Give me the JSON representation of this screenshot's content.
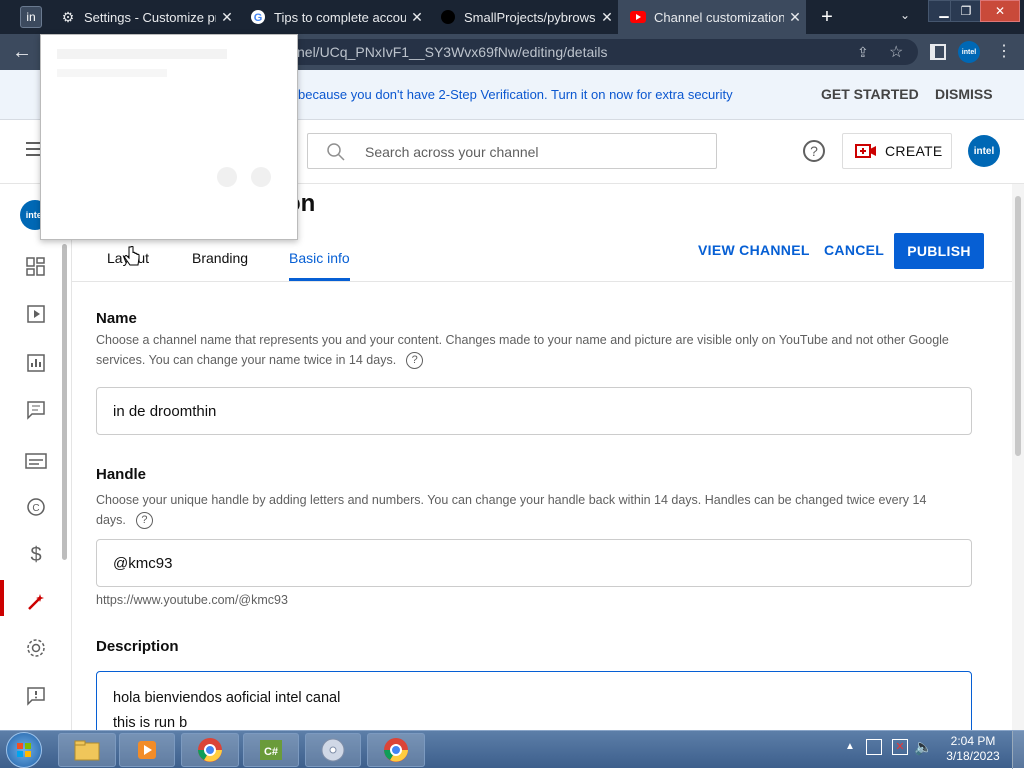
{
  "browser": {
    "tabs": [
      {
        "title": "Settings - Customize pr",
        "icon": "gear-icon"
      },
      {
        "title": "Tips to complete accou",
        "icon": "google-icon"
      },
      {
        "title": "SmallProjects/pybrowse",
        "icon": "github-icon"
      },
      {
        "title": "Channel customization",
        "icon": "youtube-icon"
      }
    ],
    "profile_badge": "in",
    "url": "nel/UCq_PNxIvF1__SY3Wvx69fNw/editing/details"
  },
  "banner": {
    "message": "because you don't have 2-Step Verification. Turn it on now for extra security",
    "get_started": "GET STARTED",
    "dismiss": "DISMISS"
  },
  "header": {
    "search_placeholder": "Search across your channel",
    "create_label": "CREATE",
    "avatar_text": "intel"
  },
  "page": {
    "title_fragment": "ation",
    "tabs": [
      "Layout",
      "Branding",
      "Basic info"
    ],
    "active_tab": "Basic info",
    "view_channel": "VIEW CHANNEL",
    "cancel": "CANCEL",
    "publish": "PUBLISH"
  },
  "form": {
    "name_label": "Name",
    "name_help": "Choose a channel name that represents you and your content. Changes made to your name and picture are visible only on YouTube and not other Google services. You can change your name twice in 14 days.",
    "name_value": "in de droomthin",
    "handle_label": "Handle",
    "handle_help": "Choose your unique handle by adding letters and numbers. You can change your handle back within 14 days. Handles can be changed twice every 14 days.",
    "handle_value": "@kmc93",
    "handle_url": "https://www.youtube.com/@kmc93",
    "description_label": "Description",
    "description_line1": "hola bienviendos aoficial intel canal",
    "description_line2": "this is run b"
  },
  "taskbar": {
    "time": "2:04 PM",
    "date": "3/18/2023"
  },
  "colors": {
    "accent": "#065fd4",
    "publish_bg": "#065fd4",
    "active_nav": "#cc0000"
  }
}
